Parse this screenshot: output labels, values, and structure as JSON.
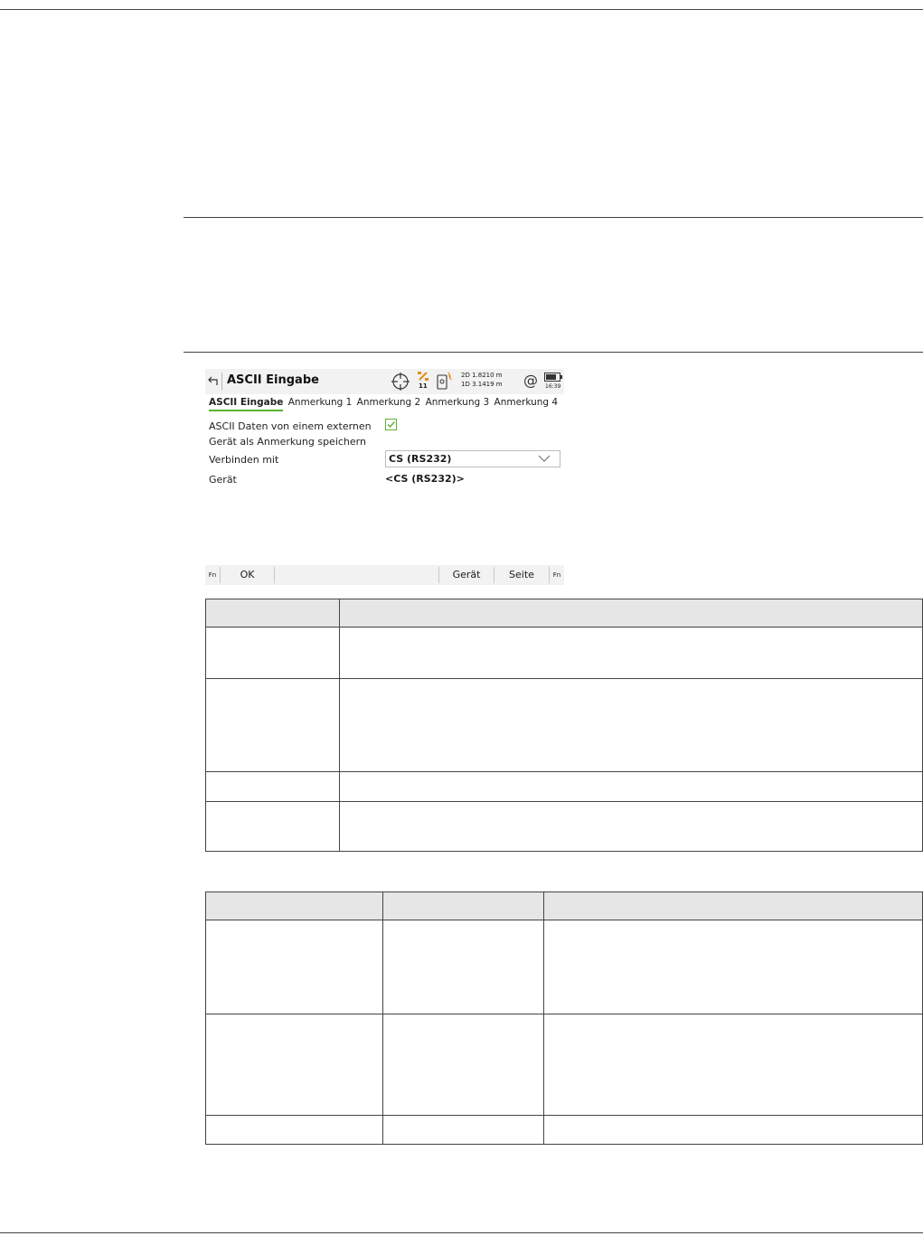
{
  "device_screen": {
    "title": "ASCII Eingabe",
    "status": {
      "satellite_count": "11",
      "quality_2d": "2D 1.8210 m",
      "quality_1d": "1D 3.1419 m",
      "clock": "16:39"
    },
    "tabs": [
      "ASCII Eingabe",
      "Anmerkung 1",
      "Anmerkung 2",
      "Anmerkung 3",
      "Anmerkung 4"
    ],
    "fields": {
      "ascii_label_line1": "ASCII Daten von einem externen",
      "ascii_label_line2": "Gerät als Anmerkung speichern",
      "ascii_checked": true,
      "connect_label": "Verbinden mit",
      "connect_value": "CS (RS232)",
      "device_label": "Gerät",
      "device_value": "<CS (RS232)>"
    },
    "softkeys": {
      "fn_left": "Fn",
      "ok": "OK",
      "device": "Gerät",
      "page": "Seite",
      "fn_right": "Fn"
    }
  },
  "colors": {
    "accent_green": "#5bb130",
    "header_gray": "#e6e6e6"
  }
}
